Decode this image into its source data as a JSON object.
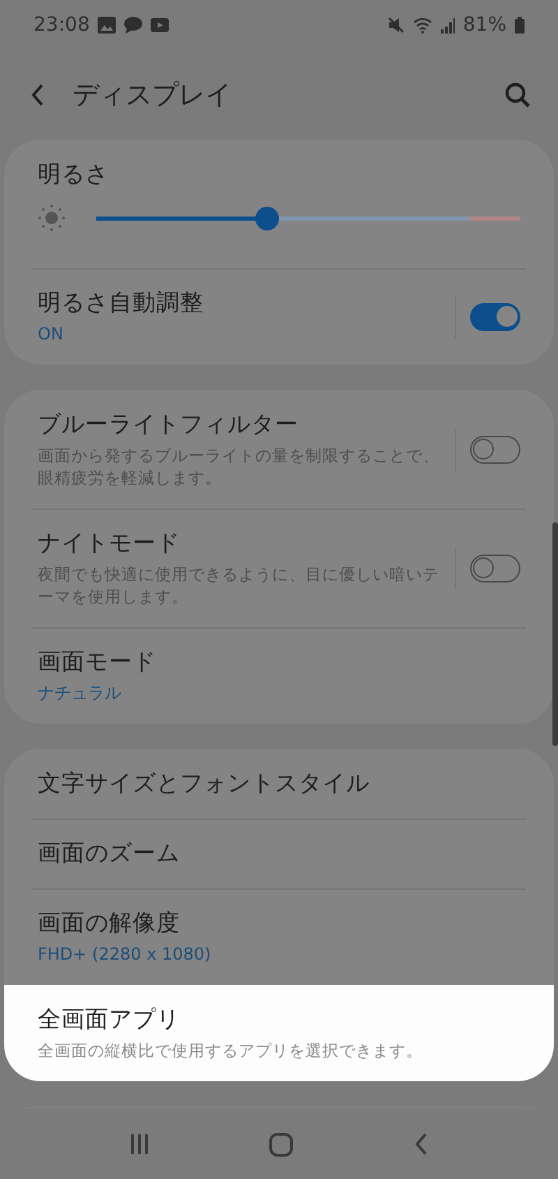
{
  "status_bar": {
    "time": "23:08",
    "battery": "81%"
  },
  "header": {
    "title": "ディスプレイ"
  },
  "groups": [
    {
      "items": [
        {
          "kind": "slider",
          "title": "明るさ",
          "level": 0.4,
          "highlighted": false
        },
        {
          "kind": "switch",
          "title": "明るさ自動調整",
          "value": "ON",
          "on": true,
          "highlighted": false
        }
      ]
    },
    {
      "items": [
        {
          "kind": "switch",
          "title": "ブルーライトフィルター",
          "description": "画面から発するブルーライトの量を制限することで、眼精疲労を軽減します。",
          "on": false,
          "highlighted": false
        },
        {
          "kind": "switch",
          "title": "ナイトモード",
          "description": "夜間でも快適に使用できるように、目に優しい暗いテーマを使用します。",
          "on": false,
          "highlighted": false
        },
        {
          "kind": "nav",
          "title": "画面モード",
          "value": "ナチュラル",
          "highlighted": false
        }
      ]
    },
    {
      "items": [
        {
          "kind": "nav",
          "title": "文字サイズとフォントスタイル",
          "highlighted": false
        },
        {
          "kind": "nav",
          "title": "画面のズーム",
          "highlighted": false
        },
        {
          "kind": "nav",
          "title": "画面の解像度",
          "value": "FHD+ (2280 x 1080)",
          "highlighted": false
        },
        {
          "kind": "nav",
          "title": "全画面アプリ",
          "description": "全画面の縦横比で使用するアプリを選択できます。",
          "highlighted": true
        }
      ]
    }
  ]
}
